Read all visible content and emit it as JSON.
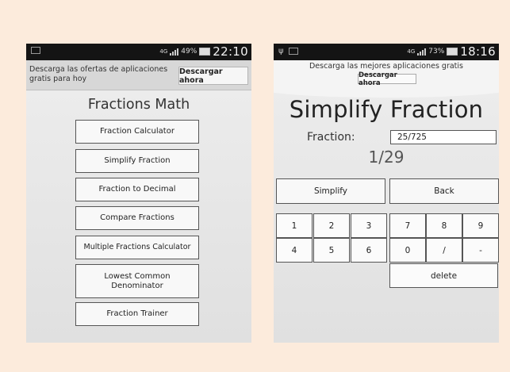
{
  "left_phone": {
    "status": {
      "network": "4G",
      "battery": "49%",
      "time": "22:10"
    },
    "ad": {
      "text": "Descarga las ofertas de aplicaciones gratis para hoy",
      "button": "Descargar ahora"
    },
    "title": "Fractions Math",
    "menu": [
      "Fraction Calculator",
      "Simplify Fraction",
      "Fraction to Decimal",
      "Compare Fractions",
      "Multiple Fractions Calculator",
      "Lowest Common Denominator",
      "Fraction Trainer"
    ]
  },
  "right_phone": {
    "status": {
      "network": "4G",
      "battery": "73%",
      "time": "18:16"
    },
    "ad": {
      "text": "Descarga las mejores aplicaciones gratis",
      "button": "Descargar ahora"
    },
    "title": "Simplify Fraction",
    "fraction_label": "Fraction:",
    "fraction_value": "25/725",
    "result": "1/29",
    "simplify_button": "Simplify",
    "back_button": "Back",
    "keys": [
      "1",
      "2",
      "3",
      "7",
      "8",
      "9",
      "4",
      "5",
      "6",
      "0",
      "/",
      "-"
    ],
    "delete_button": "delete"
  },
  "icons": {
    "notification": "sd-card-icon",
    "usb": "usb-icon",
    "signal": "signal-icon",
    "battery": "battery-icon"
  }
}
